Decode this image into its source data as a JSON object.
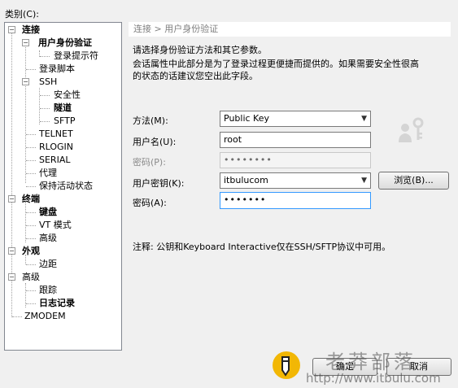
{
  "category_label": "类别(C):",
  "tree": {
    "nodes": [
      {
        "label": "连接",
        "bold": true
      },
      {
        "label": "用户身份验证",
        "bold": true
      },
      {
        "label": "登录提示符"
      },
      {
        "label": "登录脚本"
      },
      {
        "label": "SSH"
      },
      {
        "label": "安全性"
      },
      {
        "label": "隧道",
        "bold": true
      },
      {
        "label": "SFTP"
      },
      {
        "label": "TELNET"
      },
      {
        "label": "RLOGIN"
      },
      {
        "label": "SERIAL"
      },
      {
        "label": "代理"
      },
      {
        "label": "保持活动状态"
      },
      {
        "label": "终端",
        "bold": true
      },
      {
        "label": "键盘",
        "bold": true
      },
      {
        "label": "VT 模式"
      },
      {
        "label": "高级"
      },
      {
        "label": "外观",
        "bold": true
      },
      {
        "label": "边距"
      },
      {
        "label": "高级"
      },
      {
        "label": "跟踪"
      },
      {
        "label": "日志记录",
        "bold": true
      },
      {
        "label": "ZMODEM"
      }
    ]
  },
  "panel": {
    "breadcrumb": "连接 > 用户身份验证",
    "desc1": "请选择身份验证方法和其它参数。",
    "desc2": "会话属性中此部分是为了登录过程更便捷而提供的。如果需要安全性很高",
    "desc3": "的状态的话建议您空出此字段。",
    "method_label": "方法(M):",
    "method_value": "Public Key",
    "username_label": "用户名(U):",
    "username_value": "root",
    "password_label": "密码(P):",
    "password_value": "••••••••",
    "userkey_label": "用户密钥(K):",
    "userkey_value": "itbulucom",
    "browse_label": "浏览(B)...",
    "passphrase_label": "密码(A):",
    "passphrase_value": "•••••••",
    "note": "注释: 公钥和Keyboard Interactive仅在SSH/SFTP协议中可用。"
  },
  "footer": {
    "ok_label": "确定",
    "cancel_label": "取消"
  },
  "watermark": {
    "title": "老莽部落",
    "url": "http://www.itbulu.com"
  },
  "colors": {
    "selection_border": "#3399ff",
    "header_text": "#808080"
  },
  "icons": [
    "key-user-icon",
    "pencil-logo-icon",
    "chevron-down-icon",
    "tree-expand-icon"
  ]
}
